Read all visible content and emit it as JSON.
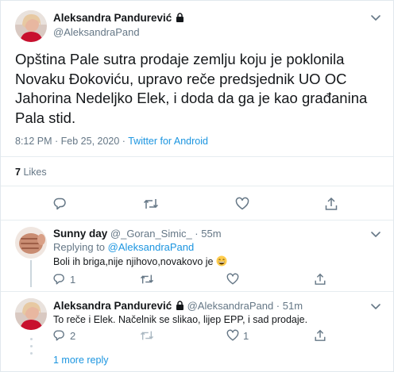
{
  "main_tweet": {
    "author_name": "Aleksandra Pandurević",
    "author_handle": "@AleksandraPand",
    "text": "Opština Pale sutra prodaje zemlju koju je poklonila Novaku Đokoviću, upravo reče predsjednik UO OC Jahorina Nedeljko Elek, i doda da ga je kao građanina Pala stid.",
    "time_date": "8:12 PM · Feb 25, 2020 · ",
    "source": "Twitter for Android",
    "likes_count": "7",
    "likes_label": "Likes"
  },
  "reply_1": {
    "author_name": "Sunny day",
    "author_handle": "@_Goran_Simic_",
    "time": " · 55m",
    "replying_prefix": "Replying to ",
    "replying_to": "@AleksandraPand",
    "text": "Boli ih briga,nije njihovo,novakovo je",
    "emoji": "😁",
    "reply_count": "1",
    "retweet_count": "",
    "like_count": ""
  },
  "reply_2": {
    "author_name": "Aleksandra Pandurević",
    "author_handle": "@AleksandraPand",
    "time": " · 51m",
    "text": "To reče i Elek. Načelnik se slikao, lijep EPP, i sad prodaje.",
    "reply_count": "2",
    "retweet_count": "",
    "like_count": "1"
  },
  "more_replies_label": "1 more reply",
  "colors": {
    "accent": "#1b95e0",
    "muted": "#657786",
    "text": "#14171a",
    "divider": "#e6ecf0"
  }
}
